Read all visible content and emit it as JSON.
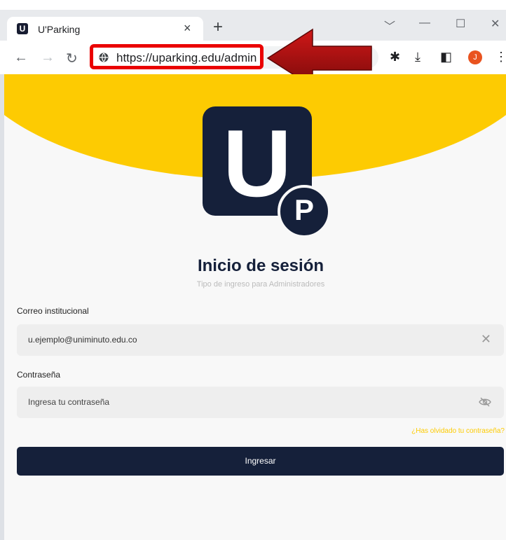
{
  "browser": {
    "tab_favicon": "U",
    "tab_title": "U'Parking",
    "tab_close": "×",
    "new_tab": "+",
    "url": "https://uparking.edu/admin",
    "avatar_letter": "J"
  },
  "login": {
    "logo_letter": "U",
    "logo_badge_letter": "P",
    "title": "Inicio de sesión",
    "subtitle": "Tipo de ingreso para Administradores",
    "email_label": "Correo institucional",
    "email_value": "u.ejemplo@uniminuto.edu.co",
    "password_label": "Contraseña",
    "password_placeholder": "Ingresa tu contraseña",
    "forgot_link": "¿Has olvidado tu contraseña?",
    "submit_label": "Ingresar"
  },
  "colors": {
    "brand_yellow": "#fdcb02",
    "brand_navy": "#15203a",
    "highlight_red": "#ea0000"
  }
}
